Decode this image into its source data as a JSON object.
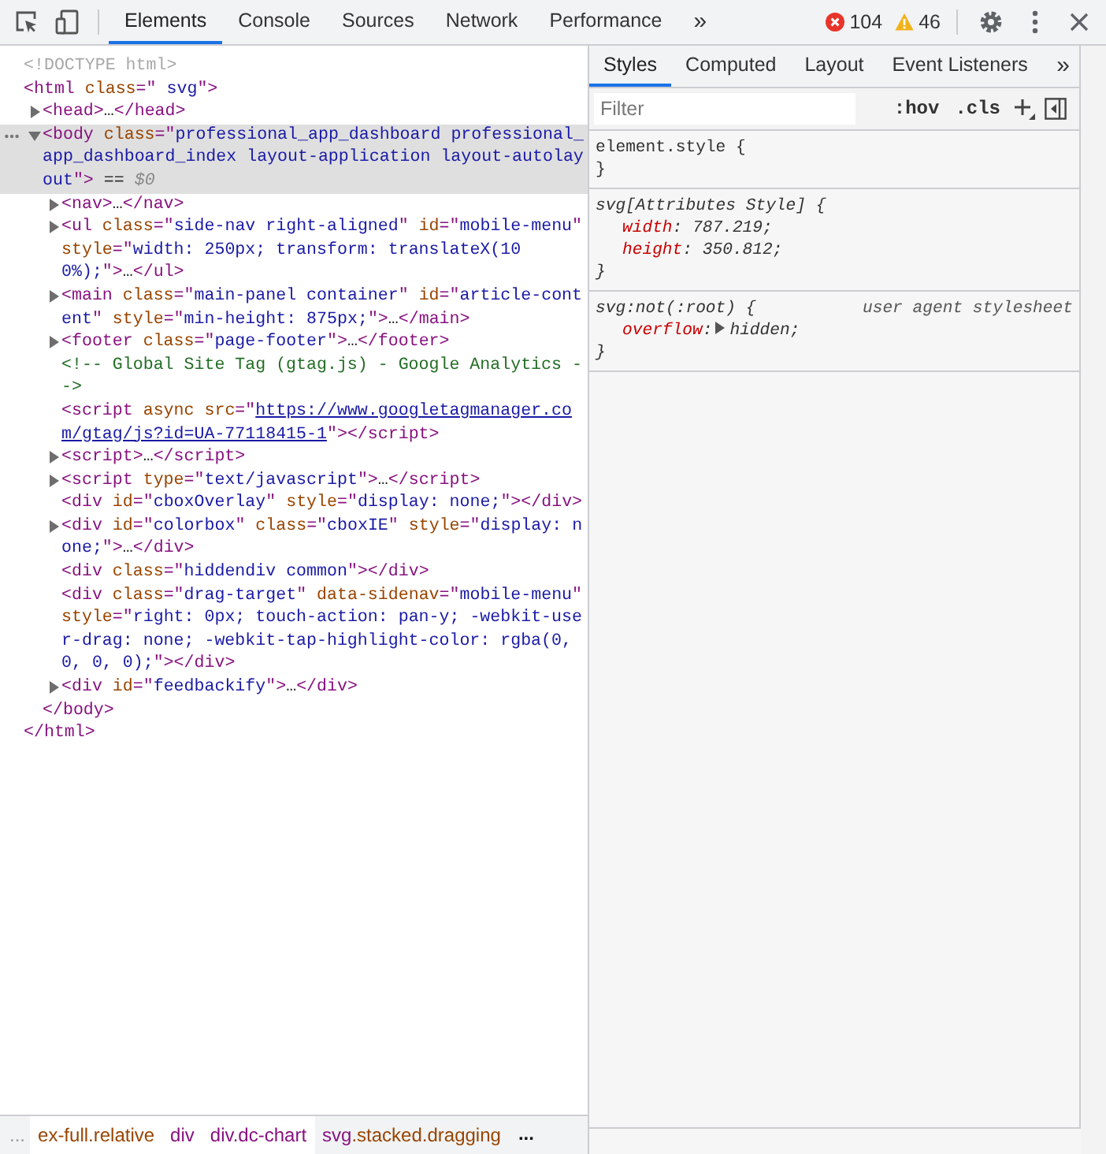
{
  "toolbar": {
    "tabs": [
      {
        "label": "Elements",
        "selected": true
      },
      {
        "label": "Console",
        "selected": false
      },
      {
        "label": "Sources",
        "selected": false
      },
      {
        "label": "Network",
        "selected": false
      },
      {
        "label": "Performance",
        "selected": false
      }
    ],
    "more_tabs": "»",
    "errors": "104",
    "warnings": "46"
  },
  "dom_tree": [
    {
      "tokens": [
        {
          "kind": "doctype",
          "text": "<!DOCTYPE html>"
        }
      ],
      "selected": false
    },
    {
      "tokens": [
        {
          "kind": "tag",
          "text": "<html"
        },
        {
          "kind": "attr",
          "text": " class"
        },
        {
          "kind": "tag",
          "text": "=\""
        },
        {
          "kind": "value",
          "text": " svg"
        },
        {
          "kind": "tag",
          "text": "\">"
        }
      ],
      "selected": false,
      "close": [
        {
          "kind": "tag",
          "text": "</html>"
        }
      ],
      "children": [
        {
          "tokens": [
            {
              "kind": "tag",
              "text": "<head>"
            },
            {
              "kind": "ellipsis",
              "text": "…"
            },
            {
              "kind": "tag",
              "text": "</head>"
            }
          ],
          "selected": false,
          "expanded": false
        },
        {
          "tokens": [
            {
              "kind": "tag",
              "text": "<body"
            },
            {
              "kind": "attr",
              "text": " class"
            },
            {
              "kind": "tag",
              "text": "=\""
            },
            {
              "kind": "value",
              "text": "professional_app_dashboard professional_app_dashboard_index layout-application layout-autolayout"
            },
            {
              "kind": "tag",
              "text": "\">"
            },
            {
              "kind": "plain",
              "text": " == "
            },
            {
              "kind": "var",
              "text": "$0"
            }
          ],
          "selected": true,
          "expanded": true,
          "close": [
            {
              "kind": "tag",
              "text": "</body>"
            }
          ],
          "children": [
            {
              "tokens": [
                {
                  "kind": "tag",
                  "text": "<nav>"
                },
                {
                  "kind": "ellipsis",
                  "text": "…"
                },
                {
                  "kind": "tag",
                  "text": "</nav>"
                }
              ],
              "selected": false,
              "expanded": false
            },
            {
              "tokens": [
                {
                  "kind": "tag",
                  "text": "<ul"
                },
                {
                  "kind": "attr",
                  "text": " class"
                },
                {
                  "kind": "tag",
                  "text": "=\""
                },
                {
                  "kind": "value",
                  "text": "side-nav right-aligned"
                },
                {
                  "kind": "tag",
                  "text": "\""
                },
                {
                  "kind": "attr",
                  "text": " id"
                },
                {
                  "kind": "tag",
                  "text": "=\""
                },
                {
                  "kind": "value",
                  "text": "mobile-menu"
                },
                {
                  "kind": "tag",
                  "text": "\""
                },
                {
                  "kind": "attr",
                  "text": " style"
                },
                {
                  "kind": "tag",
                  "text": "=\""
                },
                {
                  "kind": "value",
                  "text": "width: 250px; transform: translateX(100%);"
                },
                {
                  "kind": "tag",
                  "text": "\">"
                },
                {
                  "kind": "ellipsis",
                  "text": "…"
                },
                {
                  "kind": "tag",
                  "text": "</ul>"
                }
              ],
              "selected": false,
              "expanded": false
            },
            {
              "tokens": [
                {
                  "kind": "tag",
                  "text": "<main"
                },
                {
                  "kind": "attr",
                  "text": " class"
                },
                {
                  "kind": "tag",
                  "text": "=\""
                },
                {
                  "kind": "value",
                  "text": "main-panel container"
                },
                {
                  "kind": "tag",
                  "text": "\""
                },
                {
                  "kind": "attr",
                  "text": " id"
                },
                {
                  "kind": "tag",
                  "text": "=\""
                },
                {
                  "kind": "value",
                  "text": "article-content"
                },
                {
                  "kind": "tag",
                  "text": "\""
                },
                {
                  "kind": "attr",
                  "text": " style"
                },
                {
                  "kind": "tag",
                  "text": "=\""
                },
                {
                  "kind": "value",
                  "text": "min-height: 875px;"
                },
                {
                  "kind": "tag",
                  "text": "\">"
                },
                {
                  "kind": "ellipsis",
                  "text": "…"
                },
                {
                  "kind": "tag",
                  "text": "</main>"
                }
              ],
              "selected": false,
              "expanded": false
            },
            {
              "tokens": [
                {
                  "kind": "tag",
                  "text": "<footer"
                },
                {
                  "kind": "attr",
                  "text": " class"
                },
                {
                  "kind": "tag",
                  "text": "=\""
                },
                {
                  "kind": "value",
                  "text": "page-footer"
                },
                {
                  "kind": "tag",
                  "text": "\">"
                },
                {
                  "kind": "ellipsis",
                  "text": "…"
                },
                {
                  "kind": "tag",
                  "text": "</footer>"
                }
              ],
              "selected": false,
              "expanded": false
            },
            {
              "tokens": [
                {
                  "kind": "comment",
                  "text": "<!-- Global Site Tag (gtag.js) - Google Analytics -->"
                }
              ],
              "selected": false
            },
            {
              "tokens": [
                {
                  "kind": "tag",
                  "text": "<script"
                },
                {
                  "kind": "attr",
                  "text": " async"
                },
                {
                  "kind": "attr",
                  "text": " src"
                },
                {
                  "kind": "tag",
                  "text": "=\""
                },
                {
                  "kind": "link",
                  "text": "https://www.googletagmanager.com/gtag/js?id=UA-77118415-1"
                },
                {
                  "kind": "tag",
                  "text": "\">"
                },
                {
                  "kind": "tag",
                  "text": "</script>"
                }
              ],
              "selected": false
            },
            {
              "tokens": [
                {
                  "kind": "tag",
                  "text": "<script>"
                },
                {
                  "kind": "ellipsis",
                  "text": "…"
                },
                {
                  "kind": "tag",
                  "text": "</script>"
                }
              ],
              "selected": false,
              "expanded": false
            },
            {
              "tokens": [
                {
                  "kind": "tag",
                  "text": "<script"
                },
                {
                  "kind": "attr",
                  "text": " type"
                },
                {
                  "kind": "tag",
                  "text": "=\""
                },
                {
                  "kind": "value",
                  "text": "text/javascript"
                },
                {
                  "kind": "tag",
                  "text": "\">"
                },
                {
                  "kind": "ellipsis",
                  "text": "…"
                },
                {
                  "kind": "tag",
                  "text": "</script>"
                }
              ],
              "selected": false,
              "expanded": false
            },
            {
              "tokens": [
                {
                  "kind": "tag",
                  "text": "<div"
                },
                {
                  "kind": "attr",
                  "text": " id"
                },
                {
                  "kind": "tag",
                  "text": "=\""
                },
                {
                  "kind": "value",
                  "text": "cboxOverlay"
                },
                {
                  "kind": "tag",
                  "text": "\""
                },
                {
                  "kind": "attr",
                  "text": " style"
                },
                {
                  "kind": "tag",
                  "text": "=\""
                },
                {
                  "kind": "value",
                  "text": "display: none;"
                },
                {
                  "kind": "tag",
                  "text": "\">"
                },
                {
                  "kind": "tag",
                  "text": "</div>"
                }
              ],
              "selected": false
            },
            {
              "tokens": [
                {
                  "kind": "tag",
                  "text": "<div"
                },
                {
                  "kind": "attr",
                  "text": " id"
                },
                {
                  "kind": "tag",
                  "text": "=\""
                },
                {
                  "kind": "value",
                  "text": "colorbox"
                },
                {
                  "kind": "tag",
                  "text": "\""
                },
                {
                  "kind": "attr",
                  "text": " class"
                },
                {
                  "kind": "tag",
                  "text": "=\""
                },
                {
                  "kind": "value",
                  "text": "cboxIE"
                },
                {
                  "kind": "tag",
                  "text": "\""
                },
                {
                  "kind": "attr",
                  "text": " style"
                },
                {
                  "kind": "tag",
                  "text": "=\""
                },
                {
                  "kind": "value",
                  "text": "display: none;"
                },
                {
                  "kind": "tag",
                  "text": "\">"
                },
                {
                  "kind": "ellipsis",
                  "text": "…"
                },
                {
                  "kind": "tag",
                  "text": "</div>"
                }
              ],
              "selected": false,
              "expanded": false
            },
            {
              "tokens": [
                {
                  "kind": "tag",
                  "text": "<div"
                },
                {
                  "kind": "attr",
                  "text": " class"
                },
                {
                  "kind": "tag",
                  "text": "=\""
                },
                {
                  "kind": "value",
                  "text": "hiddendiv common"
                },
                {
                  "kind": "tag",
                  "text": "\">"
                },
                {
                  "kind": "tag",
                  "text": "</div>"
                }
              ],
              "selected": false
            },
            {
              "tokens": [
                {
                  "kind": "tag",
                  "text": "<div"
                },
                {
                  "kind": "attr",
                  "text": " class"
                },
                {
                  "kind": "tag",
                  "text": "=\""
                },
                {
                  "kind": "value",
                  "text": "drag-target"
                },
                {
                  "kind": "tag",
                  "text": "\""
                },
                {
                  "kind": "attr",
                  "text": " data-sidenav"
                },
                {
                  "kind": "tag",
                  "text": "=\""
                },
                {
                  "kind": "value",
                  "text": "mobile-menu"
                },
                {
                  "kind": "tag",
                  "text": "\""
                },
                {
                  "kind": "attr",
                  "text": " style"
                },
                {
                  "kind": "tag",
                  "text": "=\""
                },
                {
                  "kind": "value",
                  "text": "right: 0px; touch-action: pan-y; -webkit-user-drag: none; -webkit-tap-highlight-color: rgba(0, 0, 0, 0);"
                },
                {
                  "kind": "tag",
                  "text": "\">"
                },
                {
                  "kind": "tag",
                  "text": "</div>"
                }
              ],
              "selected": false
            },
            {
              "tokens": [
                {
                  "kind": "tag",
                  "text": "<div"
                },
                {
                  "kind": "attr",
                  "text": " id"
                },
                {
                  "kind": "tag",
                  "text": "=\""
                },
                {
                  "kind": "value",
                  "text": "feedbackify"
                },
                {
                  "kind": "tag",
                  "text": "\">"
                },
                {
                  "kind": "ellipsis",
                  "text": "…"
                },
                {
                  "kind": "tag",
                  "text": "</div>"
                }
              ],
              "selected": false,
              "expanded": false
            }
          ]
        }
      ]
    }
  ],
  "breadcrumbs": {
    "leading": "...",
    "items": [
      {
        "tokens": [
          {
            "kind": "attr",
            "text": "ex-full.relative"
          }
        ],
        "selected": false
      },
      {
        "tokens": [
          {
            "kind": "tag",
            "text": "div"
          }
        ],
        "selected": false
      },
      {
        "tokens": [
          {
            "kind": "tag",
            "text": "div.dc-chart"
          }
        ],
        "selected": false
      },
      {
        "tokens": [
          {
            "kind": "tag",
            "text": "svg"
          },
          {
            "kind": "attr",
            "text": ".stacked.dragging"
          }
        ],
        "selected": true
      }
    ],
    "trailing": "..."
  },
  "sidebar": {
    "tabs": [
      {
        "label": "Styles",
        "selected": true
      },
      {
        "label": "Computed",
        "selected": false
      },
      {
        "label": "Layout",
        "selected": false
      },
      {
        "label": "Event Listeners",
        "selected": false
      }
    ],
    "more_tabs": "»",
    "filter": {
      "placeholder": "Filter"
    },
    "hov": ":hov",
    "cls": ".cls",
    "rules": [
      {
        "kind": "inline",
        "selector": "element.style {",
        "close": "}"
      },
      {
        "kind": "attributes",
        "selector": "svg[Attributes Style] {",
        "props": [
          {
            "name": "width",
            "colon": ":",
            "value": "787.219;",
            "expandable": false
          },
          {
            "name": "height",
            "colon": ":",
            "value": "350.812;",
            "expandable": false
          }
        ],
        "close": "}"
      },
      {
        "kind": "user-agent",
        "selector": "svg:not(:root) {",
        "origin": "user agent stylesheet",
        "props": [
          {
            "name": "overflow",
            "colon": ":",
            "value": "hidden;",
            "expandable": true
          }
        ],
        "close": "}"
      }
    ]
  }
}
